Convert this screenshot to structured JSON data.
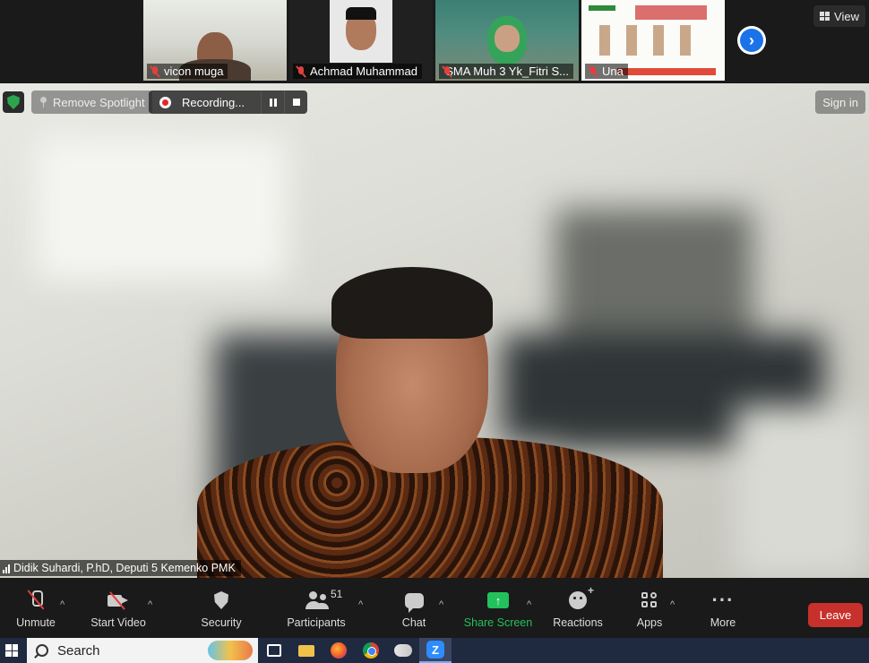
{
  "thumbnails": [
    {
      "name": "vicon muga",
      "muted": true
    },
    {
      "name": "Achmad Muhammad",
      "muted": true
    },
    {
      "name": "SMA Muh 3 Yk_Fitri S...",
      "muted": true
    },
    {
      "name": "Una",
      "muted": true
    }
  ],
  "view_button": {
    "label": "View",
    "icon": "grid-icon"
  },
  "spotlight": {
    "remove_label": "Remove Spotlight"
  },
  "recording": {
    "label": "Recording..."
  },
  "sign_in": {
    "label": "Sign in"
  },
  "active_speaker": {
    "name": "Didik Suhardi, P.hD, Deputi 5 Kemenko PMK"
  },
  "toolbar": {
    "unmute": "Unmute",
    "start_video": "Start Video",
    "security": "Security",
    "participants": "Participants",
    "participants_count": "51",
    "chat": "Chat",
    "share_screen": "Share Screen",
    "reactions": "Reactions",
    "apps": "Apps",
    "more": "More",
    "leave": "Leave"
  },
  "colors": {
    "share_green": "#23c15b",
    "leave_red": "#c7302b",
    "recording_red": "#e02828",
    "security_green": "#2ea44f"
  },
  "taskbar": {
    "search_label": "Search"
  }
}
